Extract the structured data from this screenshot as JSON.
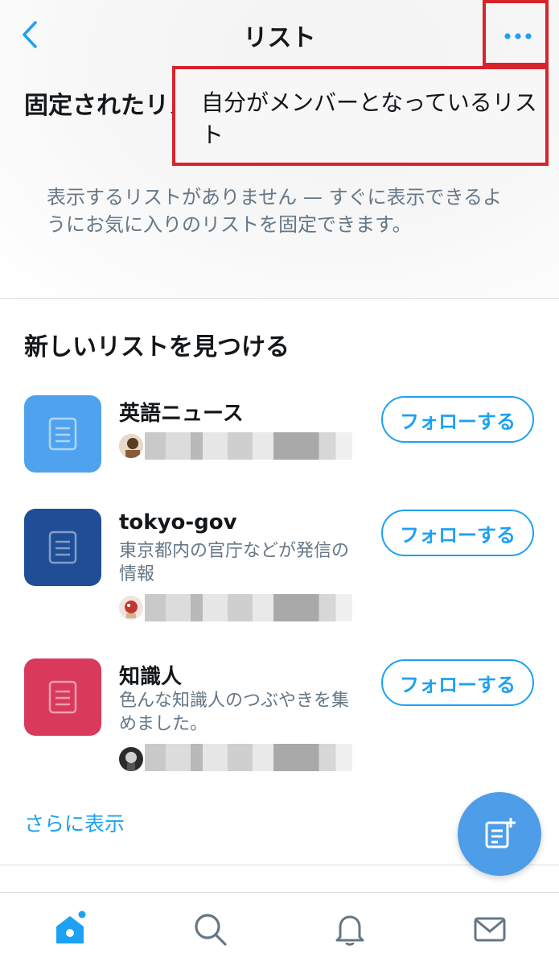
{
  "header": {
    "title": "リスト"
  },
  "menu": {
    "item_label": "自分がメンバーとなっているリスト"
  },
  "pinned": {
    "title": "固定されたリスト",
    "empty_message": "表示するリストがありません — すぐに表示できるようにお気に入りのリストを固定できます。"
  },
  "discover": {
    "title": "新しいリストを見つける",
    "lists": [
      {
        "name": "英語ニュース",
        "description": "",
        "thumb_color": "#4fa3ee",
        "follow_label": "フォローする"
      },
      {
        "name": "tokyo-gov",
        "description": "東京都内の官庁などが発信の情報",
        "thumb_color": "#1f4e96",
        "follow_label": "フォローする"
      },
      {
        "name": "知識人",
        "description": "色んな知識人のつぶやきを集めました。",
        "thumb_color": "#d93a5c",
        "follow_label": "フォローする"
      }
    ],
    "show_more": "さらに表示"
  },
  "nav": {
    "items": [
      "home-icon",
      "search-icon",
      "bell-icon",
      "mail-icon"
    ],
    "active_color": "#1da1f2"
  },
  "colors": {
    "accent": "#1da1f2",
    "highlight_border": "#d6232c"
  }
}
